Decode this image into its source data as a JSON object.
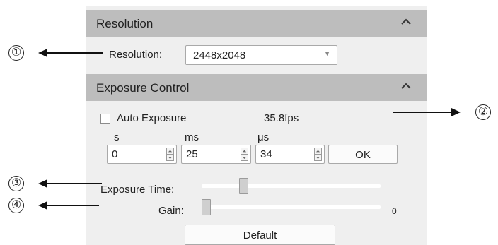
{
  "resolution_section": {
    "title": "Resolution",
    "field_label": "Resolution:",
    "selected_value": "2448x2048"
  },
  "exposure_section": {
    "title": "Exposure Control",
    "auto_exposure_label": "Auto Exposure",
    "auto_exposure_checked": false,
    "fps": "35.8fps",
    "units": {
      "s": "s",
      "ms": "ms",
      "us": "μs"
    },
    "values": {
      "s": "0",
      "ms": "25",
      "us": "34"
    },
    "ok_label": "OK",
    "exposure_time_label": "Exposure Time:",
    "exposure_time_level": 0.22,
    "gain_label": "Gain:",
    "gain_level": 0.0,
    "gain_value": "0",
    "default_label": "Default"
  },
  "annotations": [
    "①",
    "②",
    "③",
    "④"
  ],
  "icons": {
    "collapse": "chevron-up-icon",
    "dropdown": "dropdown-arrow-icon",
    "spin_up": "spin-up-icon",
    "spin_down": "spin-down-icon",
    "callout_arrow": "arrow-icon"
  }
}
